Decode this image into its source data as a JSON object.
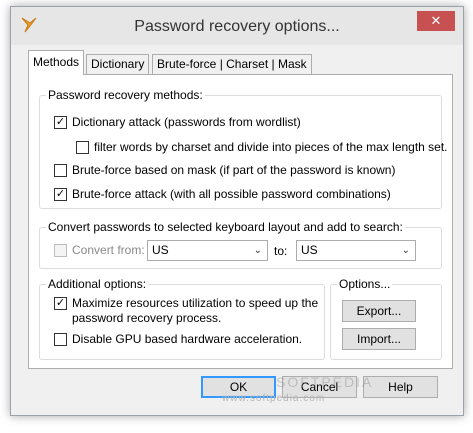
{
  "window": {
    "title": "Password recovery options...",
    "close_glyph": "✕"
  },
  "tabs": [
    "Methods",
    "Dictionary",
    "Brute-force | Charset | Mask"
  ],
  "methods": {
    "title": "Password recovery methods:",
    "items": [
      {
        "label": "Dictionary attack (passwords from wordlist)",
        "checked": true
      },
      {
        "label": "filter words by charset and divide into pieces of the max length set.",
        "checked": false
      },
      {
        "label": "Brute-force based on mask (if part of the password is known)",
        "checked": false
      },
      {
        "label": "Brute-force attack (with all possible password combinations)",
        "checked": true
      }
    ]
  },
  "convert": {
    "title": "Convert passwords to selected keyboard layout and add to search:",
    "from_label": "Convert from:",
    "from_value": "US",
    "to_label": "to:",
    "to_value": "US"
  },
  "additional": {
    "title": "Additional options:",
    "maximize": {
      "line1": "Maximize resources utilization to speed up the",
      "line2": "password recovery process.",
      "checked": true
    },
    "disable_gpu": {
      "label": "Disable GPU based hardware acceleration.",
      "checked": false
    }
  },
  "options": {
    "title": "Options...",
    "export": "Export...",
    "import": "Import..."
  },
  "footer": {
    "ok": "OK",
    "cancel": "Cancel",
    "help": "Help"
  },
  "watermark": {
    "text": "www.softpedia.com",
    "big": "SOFTPEDIA"
  },
  "glyphs": {
    "check": "✓",
    "chevron": "⌄"
  }
}
